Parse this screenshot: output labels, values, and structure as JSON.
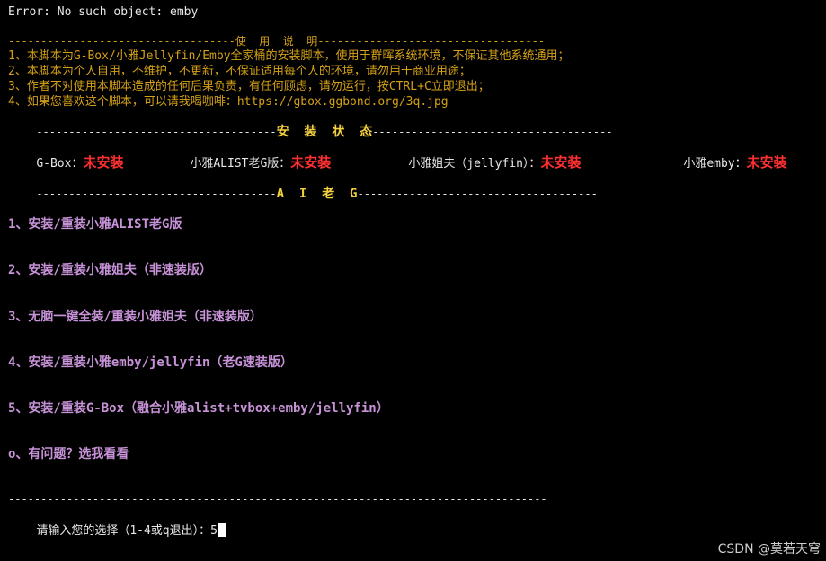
{
  "error_line": "Error: No such object: emby",
  "usage_header": "-----------------------------------使  用  说  明-----------------------------------",
  "usage_lines": [
    "1、本脚本为G-Box/小雅Jellyfin/Emby全家桶的安装脚本，使用于群晖系统环境，不保证其他系统通用；",
    "2、本脚本为个人自用，不维护，不更新，不保证适用每个人的环境，请勿用于商业用途；",
    "3、作者不对使用本脚本造成的任何后果负责，有任何顾虑，请勿运行，按CTRL+C立即退出；",
    "4、如果您喜欢这个脚本，可以请我喝咖啡：https://gbox.ggbond.org/3q.jpg"
  ],
  "status_header_left": "-------------------------------------",
  "status_header_title": "安  装  状  态",
  "status_header_right": "-------------------------------------",
  "status": [
    {
      "label": "G-Box：",
      "value": "未安装"
    },
    {
      "label": "小雅ALIST老G版：",
      "value": "未安装"
    },
    {
      "label": "小雅姐夫（jellyfin）：",
      "value": "未安装"
    },
    {
      "label": "小雅emby：",
      "value": "未安装"
    }
  ],
  "aig_header_left": "-------------------------------------",
  "aig_header_title": "A  I  老  G",
  "aig_header_right": "-------------------------------------",
  "menu": [
    "1、安装/重装小雅ALIST老G版",
    "2、安装/重装小雅姐夫（非速装版）",
    "3、无脑一键全装/重装小雅姐夫（非速装版）",
    "4、安装/重装小雅emby/jellyfin（老G速装版）",
    "5、安装/重装G-Box（融合小雅alist+tvbox+emby/jellyfin）",
    "o、有问题？选我看看"
  ],
  "bottom_rule": "-----------------------------------------------------------------------------------",
  "prompt": "请输入您的选择（1-4或q退出）：5",
  "watermark": "CSDN @莫若天穹",
  "colors": {
    "background": "#000000",
    "text": "#e8e8e8",
    "usage": "#d4a017",
    "status_value": "#ff3030",
    "menu": "#c792d8",
    "header_title": "#f4d03f"
  }
}
